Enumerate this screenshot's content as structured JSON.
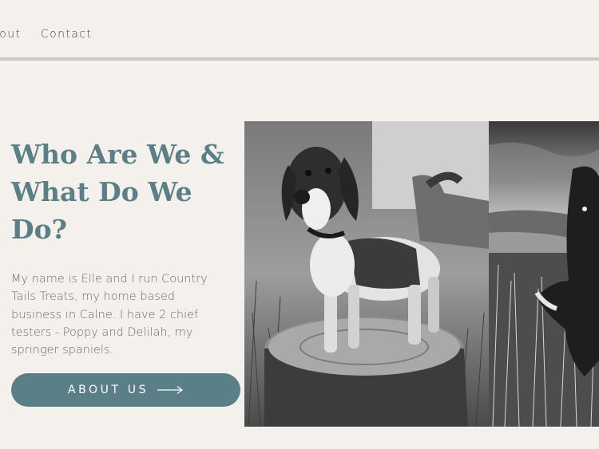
{
  "nav": {
    "about_label": "About",
    "contact_label": "Contact"
  },
  "hero": {
    "headline": "Who Are We & What Do We Do?",
    "body": "My name is Elle and I run Country Tails Treats, my home based business in Calne. I have 2 chief testers -  Poppy  and Delilah, my springer spaniels.",
    "cta_label": "ABOUT US"
  },
  "colors": {
    "background": "#f4f1ec",
    "accent": "#5b7f86",
    "nav_rule": "#c9c8c5",
    "body_text": "#6b6b6b"
  },
  "icons": {
    "cta_arrow": "long-right-arrow-icon"
  },
  "images": [
    {
      "depicts": "springer-spaniel-on-tree-stump"
    },
    {
      "depicts": "spaniel-on-hillside"
    }
  ]
}
